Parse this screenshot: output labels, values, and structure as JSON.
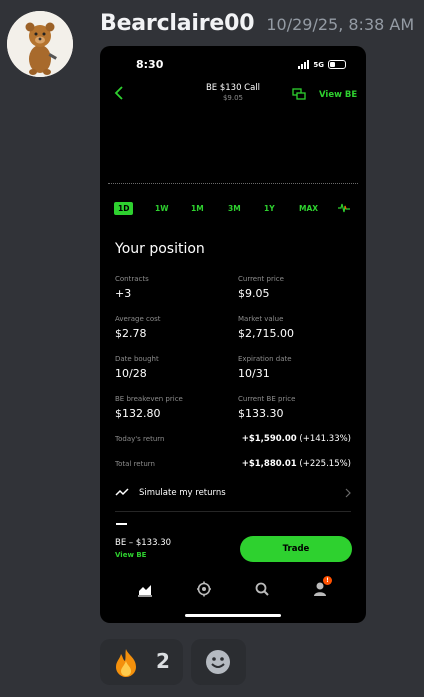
{
  "message": {
    "username": "Bearclaire00",
    "timestamp": "10/29/25, 8:38 AM",
    "avatar_icon": "teddy-bear-avatar"
  },
  "phone": {
    "status_time": "8:30",
    "network": "5G",
    "nav": {
      "title": "BE $130 Call",
      "subtitle": "$9.05",
      "view_label": "View BE"
    },
    "ranges": [
      {
        "label": "1D",
        "active": true
      },
      {
        "label": "1W",
        "active": false
      },
      {
        "label": "1M",
        "active": false
      },
      {
        "label": "3M",
        "active": false
      },
      {
        "label": "1Y",
        "active": false
      },
      {
        "label": "MAX",
        "active": false
      }
    ],
    "position": {
      "title": "Your position",
      "fields": [
        {
          "label": "Contracts",
          "value": "+3"
        },
        {
          "label": "Current price",
          "value": "$9.05"
        },
        {
          "label": "Average cost",
          "value": "$2.78"
        },
        {
          "label": "Market value",
          "value": "$2,715.00"
        },
        {
          "label": "Date bought",
          "value": "10/28"
        },
        {
          "label": "Expiration date",
          "value": "10/31"
        },
        {
          "label": "BE breakeven price",
          "value": "$132.80"
        },
        {
          "label": "Current BE price",
          "value": "$133.30"
        }
      ],
      "todays_return": {
        "label": "Today's return",
        "value": "+$1,590.00",
        "pct": "(+141.33%)"
      },
      "total_return": {
        "label": "Total return",
        "value": "+$1,880.01",
        "pct": "(+225.15%)"
      },
      "simulate_label": "Simulate my returns"
    },
    "bottom": {
      "quote": "BE – $133.30",
      "view_label": "View BE",
      "trade_label": "Trade"
    },
    "tabs": [
      "chart-tab-icon",
      "crypto-tab-icon",
      "search-tab-icon",
      "account-tab-icon"
    ],
    "badge": "!"
  },
  "reactions": [
    {
      "emoji": "fire-emoji-icon",
      "count": "2"
    },
    {
      "emoji": "add-reaction-icon"
    }
  ],
  "colors": {
    "accent": "#2ed12f",
    "background": "#313338",
    "badge": "#ff5000"
  }
}
